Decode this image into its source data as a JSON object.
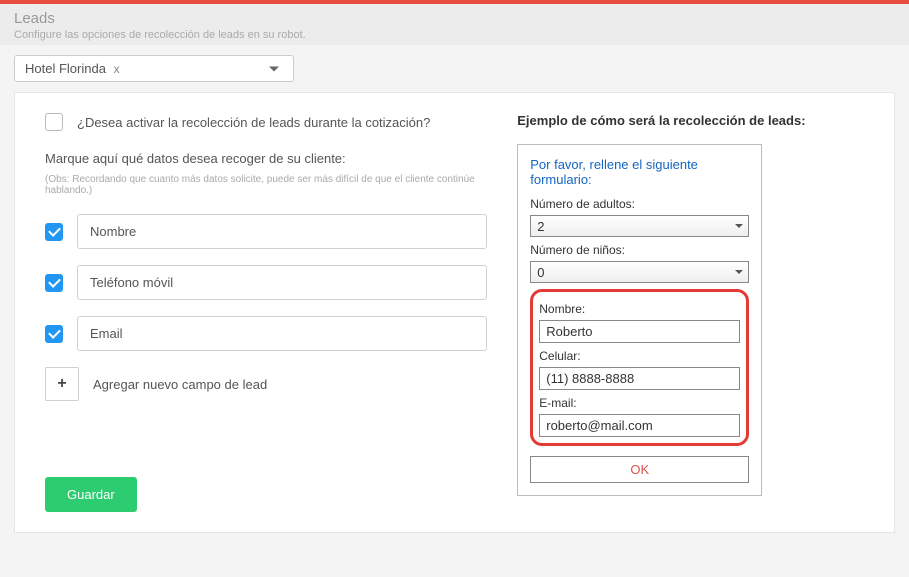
{
  "header": {
    "title": "Leads",
    "subtitle": "Configure las opciones de recolección de leads en su robot."
  },
  "hotelSelect": {
    "selected": "Hotel Florinda"
  },
  "left": {
    "activateQuestion": "¿Desea activar la recolección de leads durante la cotización?",
    "collectLabel": "Marque aquí qué datos desea recoger de su cliente:",
    "obs": "(Obs: Recordando que cuanto más datos solicite, puede ser más difícil de que el cliente continúe hablando.)",
    "fields": {
      "name": "Nombre",
      "phone": "Teléfono móvil",
      "email": "Email"
    },
    "addNew": "Agregar nuevo campo de lead",
    "save": "Guardar"
  },
  "preview": {
    "title": "Ejemplo de cómo será la recolección de leads:",
    "heading": "Por favor, rellene el siguiente formulario:",
    "adultsLabel": "Número de adultos:",
    "adultsValue": "2",
    "kidsLabel": "Número de niños:",
    "kidsValue": "0",
    "nameLabel": "Nombre:",
    "nameValue": "Roberto",
    "phoneLabel": "Celular:",
    "phoneValue": "(11) 8888-8888",
    "emailLabel": "E-mail:",
    "emailValue": "roberto@mail.com",
    "ok": "OK"
  }
}
